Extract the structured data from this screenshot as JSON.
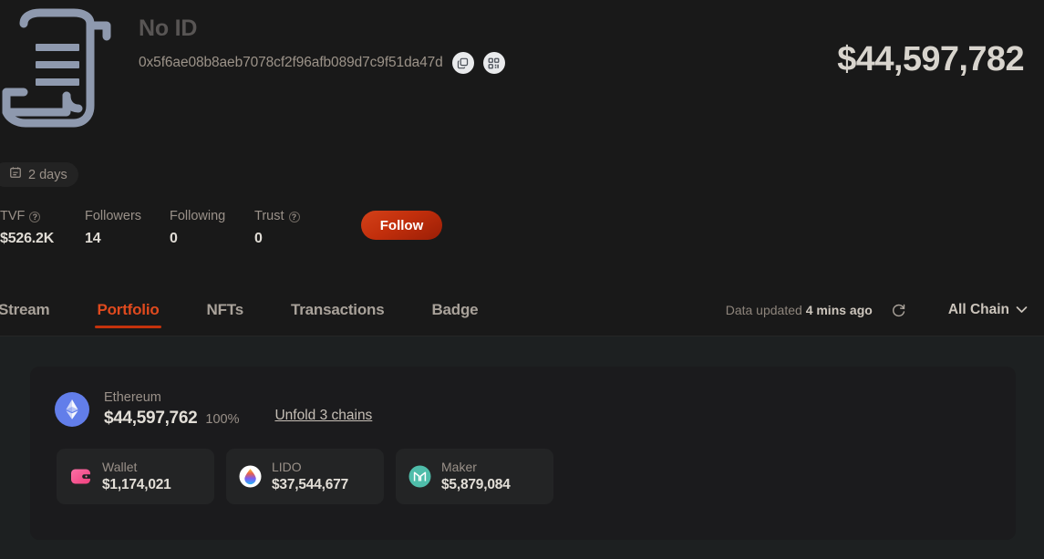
{
  "profile": {
    "avatar_icon": "scroll-document-icon",
    "display_name": "No ID",
    "address": "0x5f6ae08b8aeb7078cf2f96afb089d7c9f51da47d",
    "copy_icon": "copy-icon",
    "qr_icon": "qr-code-icon",
    "total_balance": "$44,597,782",
    "age_badge": {
      "icon": "calendar-icon",
      "label": "2 days"
    }
  },
  "stats": [
    {
      "label": "TVF",
      "has_help": true,
      "value": "$526.2K"
    },
    {
      "label": "Followers",
      "has_help": false,
      "value": "14"
    },
    {
      "label": "Following",
      "has_help": false,
      "value": "0"
    },
    {
      "label": "Trust",
      "has_help": true,
      "value": "0"
    }
  ],
  "follow_button": {
    "label": "Follow"
  },
  "tabs": [
    {
      "label": "Stream",
      "active": false
    },
    {
      "label": "Portfolio",
      "active": true
    },
    {
      "label": "NFTs",
      "active": false
    },
    {
      "label": "Transactions",
      "active": false
    },
    {
      "label": "Badge",
      "active": false
    }
  ],
  "toolbar": {
    "data_updated_prefix": "Data updated ",
    "data_updated_time": "4 mins ago",
    "refresh_icon": "refresh-icon",
    "chain_filter": "All Chain",
    "chain_chevron_icon": "chevron-down-icon"
  },
  "portfolio": {
    "chain": {
      "logo_icon": "ethereum-icon",
      "name": "Ethereum",
      "amount": "$44,597,762",
      "percent": "100%"
    },
    "unfold_link": "Unfold 3 chains",
    "protocols": [
      {
        "icon": "wallet-icon",
        "name": "Wallet",
        "amount": "$1,174,021"
      },
      {
        "icon": "lido-icon",
        "name": "LIDO",
        "amount": "$37,544,677"
      },
      {
        "icon": "maker-icon",
        "name": "Maker",
        "amount": "$5,879,084"
      }
    ]
  },
  "colors": {
    "page_bg": "#191919",
    "body_bg": "#1d2021",
    "card_bg": "#1b1b1d",
    "accent": "#e04a1e",
    "accent_underline": "#c4320c",
    "ethereum": "#627eea",
    "maker": "#4fbdaa",
    "avatar": "#8e99ae"
  }
}
